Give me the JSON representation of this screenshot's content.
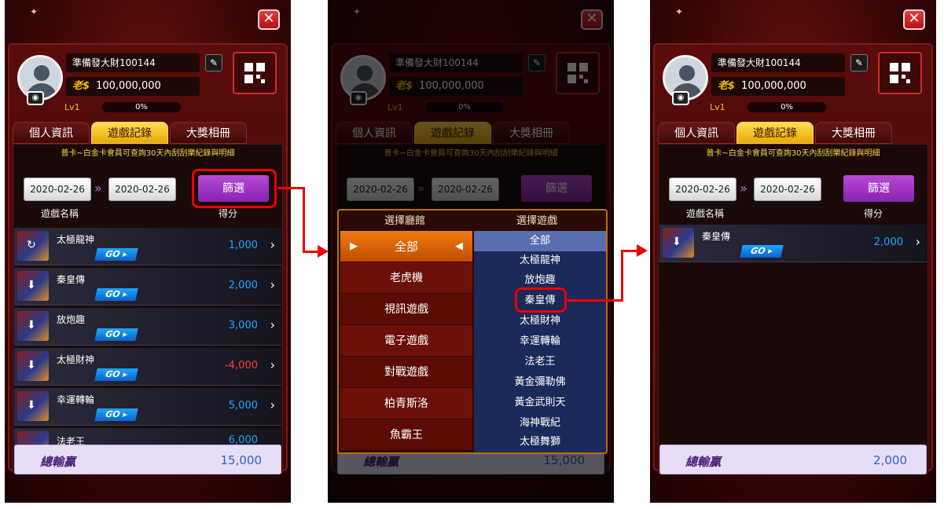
{
  "profile": {
    "name": "準備發大財100144",
    "currency_symbol": "老$",
    "balance": "100,000,000",
    "level": "Lv1",
    "progress_text": "0%"
  },
  "tabs": [
    "個人資訊",
    "遊戲記錄",
    "大獎相冊"
  ],
  "notice": "普卡~白金卡會員可查詢30天內刮刮樂紀錄與明細",
  "filter": {
    "start_date": "2020-02-26",
    "end_date": "2020-02-26",
    "button_label": "篩選"
  },
  "columns": {
    "game_name": "遊戲名稱",
    "score": "得分"
  },
  "go_label": "GO",
  "screen1_rows": [
    {
      "name": "太極龍神",
      "score": "1,000"
    },
    {
      "name": "秦皇傳",
      "score": "2,000"
    },
    {
      "name": "放炮趣",
      "score": "3,000"
    },
    {
      "name": "太極財神",
      "score": "-4,000"
    },
    {
      "name": "幸運轉輪",
      "score": "5,000"
    },
    {
      "name": "法老王",
      "score": "6,000"
    }
  ],
  "total_label": "總輸贏",
  "screen1_total": "15,000",
  "dialog": {
    "venue_header": "選擇廳館",
    "game_header": "選擇遊戲",
    "venues": [
      "全部",
      "老虎機",
      "視訊遊戲",
      "電子遊戲",
      "對戰遊戲",
      "柏青斯洛",
      "魚霸王"
    ],
    "games": [
      "全部",
      "太極龍神",
      "放炮趣",
      "秦皇傳",
      "太極財神",
      "幸運轉輪",
      "法老王",
      "黃金彌勒佛",
      "黃金武則天",
      "海神戰紀",
      "太極舞獅"
    ]
  },
  "screen3_rows": [
    {
      "name": "秦皇傳",
      "score": "2,000"
    }
  ],
  "screen3_total": "2,000"
}
